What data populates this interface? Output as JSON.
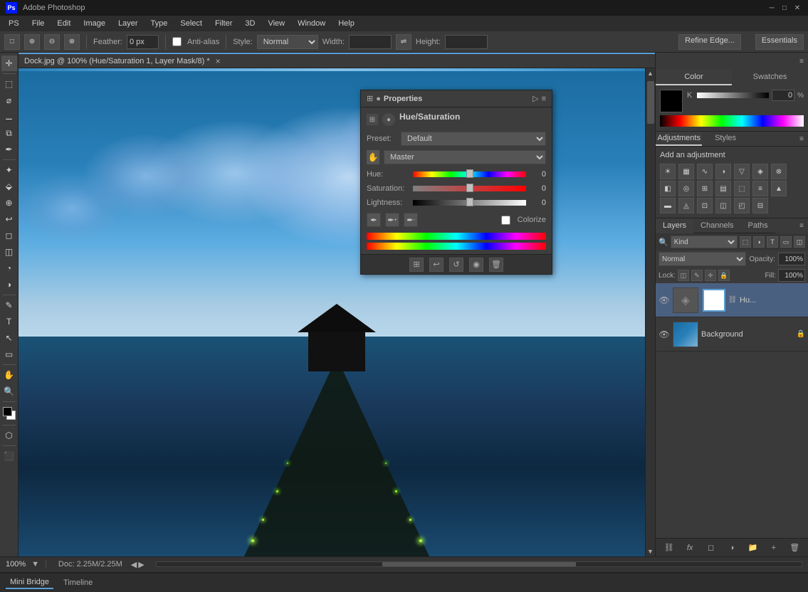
{
  "titlebar": {
    "ps_label": "PS",
    "title": "Adobe Photoshop",
    "btn_min": "─",
    "btn_max": "□",
    "btn_close": "✕"
  },
  "menubar": {
    "items": [
      "PS",
      "File",
      "Edit",
      "Image",
      "Layer",
      "Type",
      "Select",
      "Filter",
      "3D",
      "View",
      "Window",
      "Help"
    ]
  },
  "optionsbar": {
    "feather_label": "Feather:",
    "feather_value": "0 px",
    "anti_alias_label": "Anti-alias",
    "style_label": "Style:",
    "style_value": "Normal",
    "width_label": "Width:",
    "height_label": "Height:",
    "refine_edge_label": "Refine Edge...",
    "essentials_label": "Essentials"
  },
  "canvas": {
    "tab_label": "Dock.jpg @ 100% (Hue/Saturation 1, Layer Mask/8) *",
    "tab_close": "×"
  },
  "properties_panel": {
    "title": "Properties",
    "panel_icon1": "⊞",
    "panel_icon2": "●",
    "section_title": "Hue/Saturation",
    "preset_label": "Preset:",
    "preset_value": "Default",
    "channel_label": "Master",
    "hue_label": "Hue:",
    "hue_value": "0",
    "saturation_label": "Saturation:",
    "saturation_value": "0",
    "lightness_label": "Lightness:",
    "lightness_value": "0",
    "colorize_label": "Colorize",
    "hue_slider_pct": 50,
    "sat_slider_pct": 50,
    "light_slider_pct": 50
  },
  "right_panel": {
    "color_tab": "Color",
    "swatches_tab": "Swatches",
    "k_label": "K",
    "k_value": "0",
    "pct_label": "%",
    "adjustments_tab": "Adjustments",
    "styles_tab": "Styles",
    "add_adjustment_label": "Add an adjustment",
    "layers_tab": "Layers",
    "channels_tab": "Channels",
    "paths_tab": "Paths",
    "kind_label": "Kind",
    "normal_label": "Normal",
    "opacity_label": "Opacity:",
    "opacity_value": "100%",
    "lock_label": "Lock:",
    "fill_label": "Fill:",
    "fill_value": "100%",
    "layer1_name": "Hu...",
    "layer2_name": "Background",
    "essentials_btn": "Essentials ▾"
  },
  "statusbar": {
    "zoom": "100%",
    "doc": "Doc: 2.25M/2.25M"
  },
  "bottombar": {
    "minibridge_label": "Mini Bridge",
    "timeline_label": "Timeline"
  }
}
